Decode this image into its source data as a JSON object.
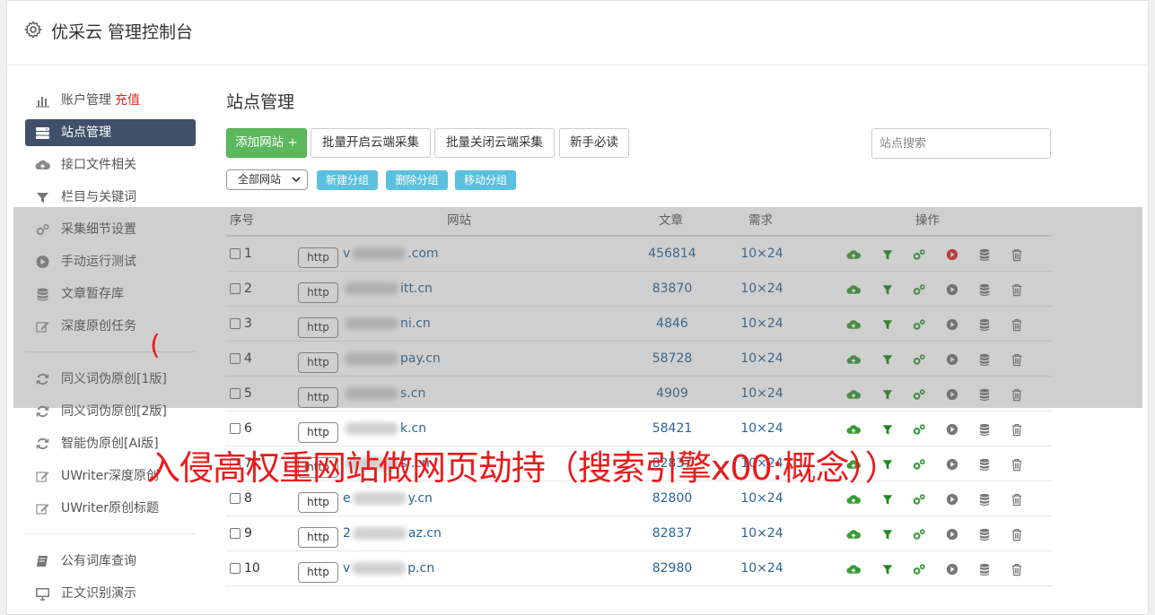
{
  "header": {
    "title": "优采云 管理控制台",
    "icon": "gear-icon"
  },
  "sidebar": {
    "items": [
      {
        "label": "账户管理",
        "extra": "充值",
        "icon": "bar-chart-icon",
        "active": false
      },
      {
        "label": "站点管理",
        "icon": "server-icon",
        "active": true
      },
      {
        "label": "接口文件相关",
        "icon": "cloud-upload-icon",
        "active": false
      },
      {
        "label": "栏目与关键词",
        "icon": "filter-icon",
        "active": false
      },
      {
        "label": "采集细节设置",
        "icon": "gears-icon",
        "active": false
      },
      {
        "label": "手动运行测试",
        "icon": "play-circle-icon",
        "active": false
      },
      {
        "label": "文章暂存库",
        "icon": "database-icon",
        "active": false
      },
      {
        "label": "深度原创任务",
        "icon": "edit-icon",
        "active": false
      }
    ],
    "items2": [
      {
        "label": "同义词伪原创[1版]",
        "icon": "refresh-icon"
      },
      {
        "label": "同义词伪原创[2版]",
        "icon": "refresh-icon"
      },
      {
        "label": "智能伪原创[AI版]",
        "icon": "refresh-icon"
      },
      {
        "label": "UWriter深度原创",
        "icon": "edit-icon"
      },
      {
        "label": "UWriter原创标题",
        "icon": "edit-icon"
      }
    ],
    "items3": [
      {
        "label": "公有词库查询",
        "icon": "book-icon"
      },
      {
        "label": "正文识别演示",
        "icon": "monitor-icon"
      }
    ]
  },
  "main": {
    "title": "站点管理",
    "buttons": {
      "add": "添加网站 +",
      "enable_cloud": "批量开启云端采集",
      "disable_cloud": "批量关闭云端采集",
      "guide": "新手必读"
    },
    "search_placeholder": "站点搜索",
    "group_select": "全部网站",
    "group_buttons": {
      "new": "新建分组",
      "delete": "删除分组",
      "move": "移动分组"
    },
    "table": {
      "headers": {
        "no": "序号",
        "site": "网站",
        "articles": "文章",
        "demand": "需求",
        "ops": "操作"
      },
      "rows": [
        {
          "no": "1",
          "proto": "http",
          "site_prefix": "v",
          "site_suffix": ".com",
          "articles": "456814",
          "demand": "10×24",
          "running": true
        },
        {
          "no": "2",
          "proto": "http",
          "site_prefix": "",
          "site_suffix": "itt.cn",
          "articles": "83870",
          "demand": "10×24",
          "running": false
        },
        {
          "no": "3",
          "proto": "http",
          "site_prefix": "",
          "site_suffix": "ni.cn",
          "articles": "4846",
          "demand": "10×24",
          "running": false
        },
        {
          "no": "4",
          "proto": "http",
          "site_prefix": "",
          "site_suffix": "pay.cn",
          "articles": "58728",
          "demand": "10×24",
          "running": false
        },
        {
          "no": "5",
          "proto": "http",
          "site_prefix": "",
          "site_suffix": "s.cn",
          "articles": "4909",
          "demand": "10×24",
          "running": false
        },
        {
          "no": "6",
          "proto": "http",
          "site_prefix": "",
          "site_suffix": "k.cn",
          "articles": "58421",
          "demand": "10×24",
          "running": false
        },
        {
          "no": "7",
          "proto": "http",
          "site_prefix": "",
          "site_suffix": "s  .cn",
          "articles": "82837",
          "demand": "10×24",
          "running": false
        },
        {
          "no": "8",
          "proto": "http",
          "site_prefix": "e",
          "site_suffix": "y.cn",
          "articles": "82800",
          "demand": "10×24",
          "running": false
        },
        {
          "no": "9",
          "proto": "http",
          "site_prefix": "2",
          "site_suffix": "az.cn",
          "articles": "82837",
          "demand": "10×24",
          "running": false
        },
        {
          "no": "10",
          "proto": "http",
          "site_prefix": "v",
          "site_suffix": "p.cn",
          "articles": "82980",
          "demand": "10×24",
          "running": false
        }
      ]
    }
  },
  "overlay": {
    "watermark": "入侵高权重网站做网页劫持（搜索引擎x00:概念））",
    "paren": "("
  },
  "colors": {
    "accent": "#3f5068",
    "green": "#5cb85c",
    "info": "#5bc0de",
    "watermark": "#e81b1b",
    "link": "#2a6496"
  }
}
